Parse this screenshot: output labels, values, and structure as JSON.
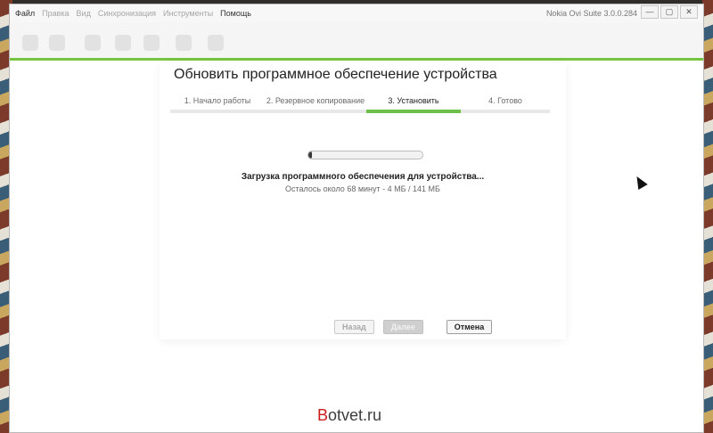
{
  "window": {
    "app_title": "Nokia Ovi Suite 3.0.0.284",
    "menu": [
      {
        "label": "Файл",
        "enabled": true
      },
      {
        "label": "Правка",
        "enabled": false
      },
      {
        "label": "Вид",
        "enabled": false
      },
      {
        "label": "Синхронизация",
        "enabled": false
      },
      {
        "label": "Инструменты",
        "enabled": false
      },
      {
        "label": "Помощь",
        "enabled": true
      }
    ],
    "controls": {
      "minimize": "—",
      "maximize": "▢",
      "close": "✕"
    }
  },
  "dialog": {
    "title": "Обновить программное обеспечение устройства",
    "steps": [
      {
        "label": "1. Начало работы",
        "active": false
      },
      {
        "label": "2. Резервное копирование",
        "active": false
      },
      {
        "label": "3. Установить",
        "active": true
      },
      {
        "label": "4. Готово",
        "active": false
      }
    ],
    "progress_fraction": 0.03,
    "status_main": "Загрузка программного обеспечения для устройства...",
    "status_sub": "Осталось около 68 минут - 4 МБ / 141 МБ",
    "buttons": {
      "back": "Назад",
      "next": "Далее",
      "cancel": "Отмена"
    }
  },
  "watermark": {
    "first": "B",
    "rest": "otvet.ru"
  },
  "colors": {
    "accent_green": "#6cc04a",
    "toolbar_green": "#76c442"
  }
}
